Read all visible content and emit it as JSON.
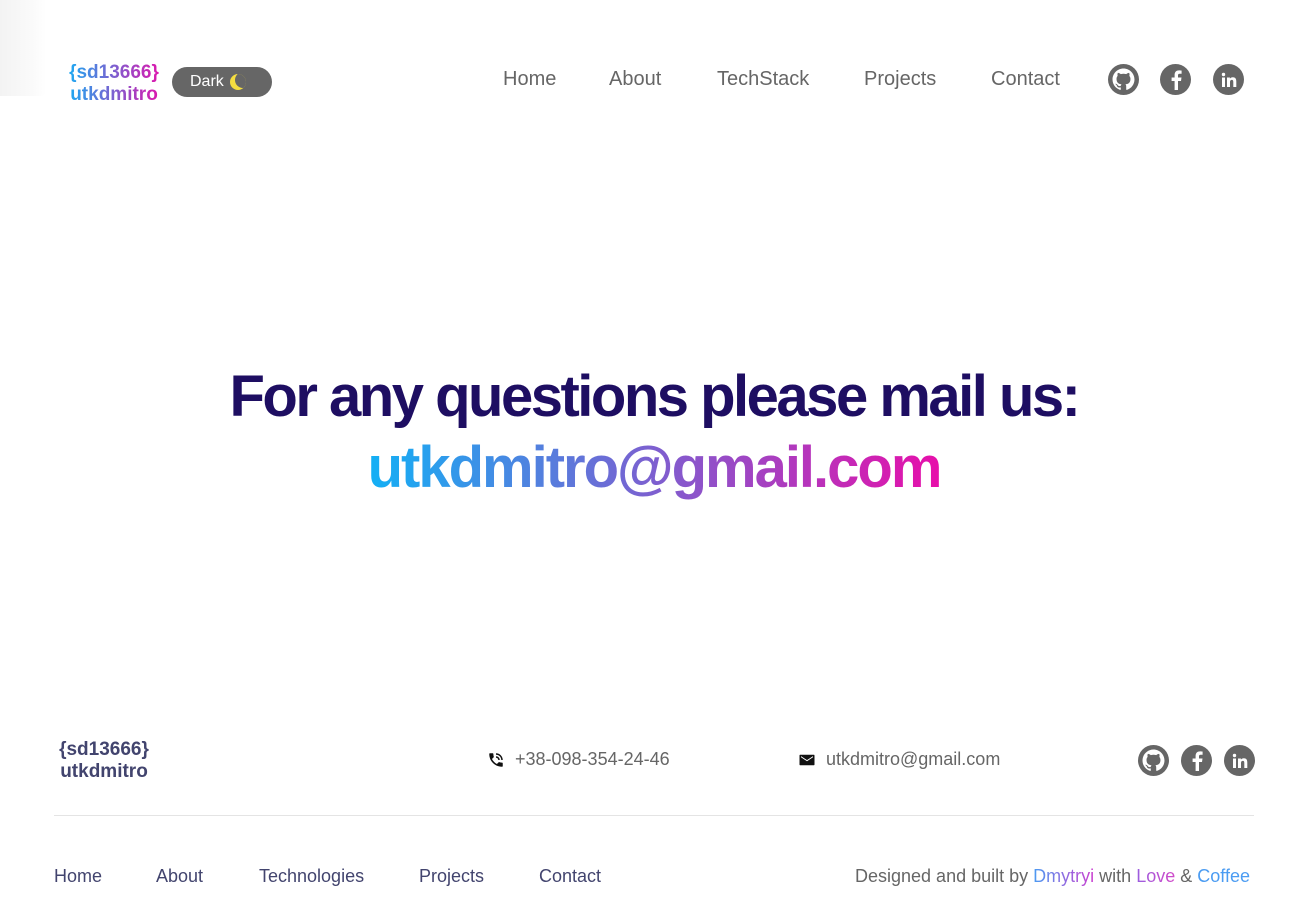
{
  "header": {
    "logo_line1": "{sd13666}",
    "logo_line2": "utkdmitro",
    "theme_toggle_label": "Dark",
    "nav": [
      "Home",
      "About",
      "TechStack",
      "Projects",
      "Contact"
    ],
    "social_icons": [
      "github-icon",
      "facebook-icon",
      "linkedin-icon"
    ]
  },
  "hero": {
    "title": "For any questions please mail us:",
    "email": "utkdmitro@gmail.com"
  },
  "footer": {
    "logo_line1": "{sd13666}",
    "logo_line2": "utkdmitro",
    "phone": "+38-098-354-24-46",
    "email": "utkdmitro@gmail.com",
    "nav": [
      "Home",
      "About",
      "Technologies",
      "Projects",
      "Contact"
    ],
    "credits": {
      "prefix": "Designed and built by",
      "author": "Dmytryi",
      "with": "with",
      "love": "Love",
      "amp": "&",
      "coffee": "Coffee"
    }
  },
  "colors": {
    "gradient_start": "#13b0f5",
    "gradient_end": "#e70faa",
    "heading": "#1e0e62",
    "text_muted": "#666666"
  }
}
